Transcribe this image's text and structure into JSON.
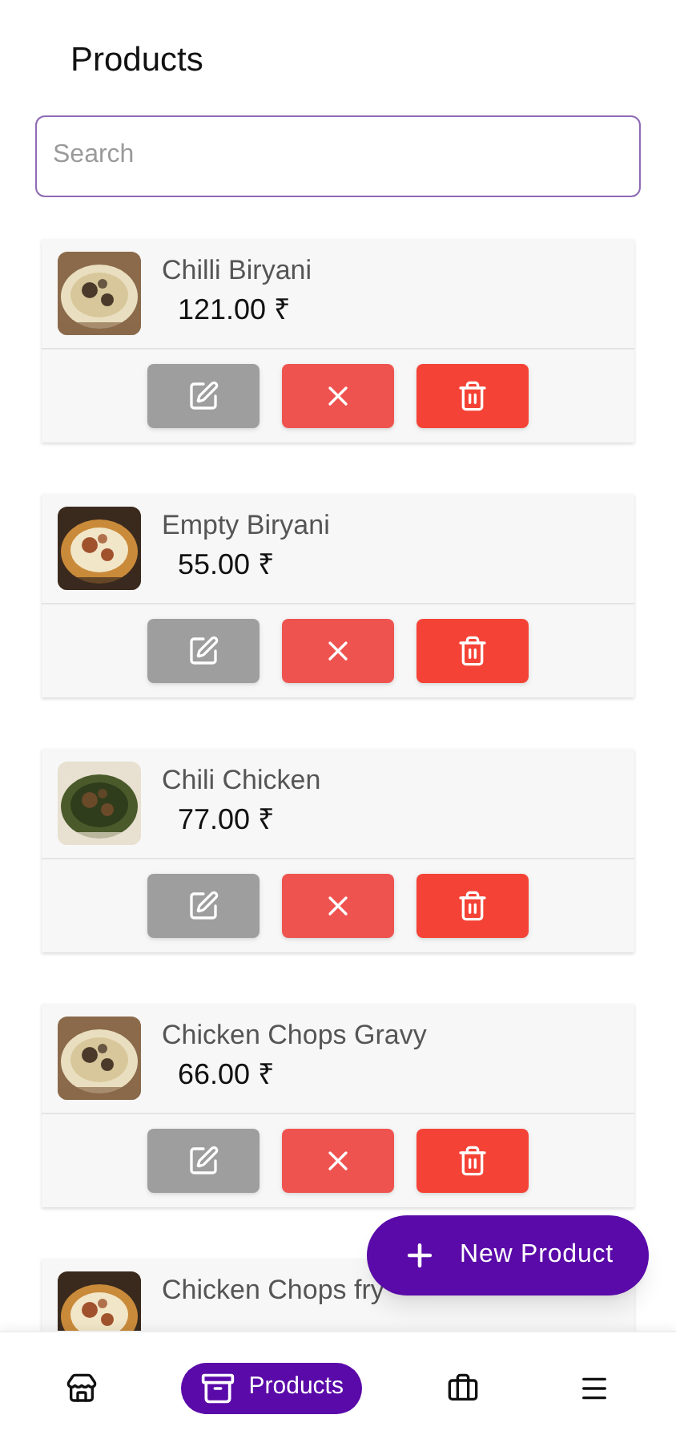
{
  "header": {
    "title": "Products"
  },
  "search": {
    "placeholder": "Search"
  },
  "products": [
    {
      "name": "Chilli Biryani",
      "price": "121.00 ₹"
    },
    {
      "name": "Empty Biryani",
      "price": "55.00 ₹"
    },
    {
      "name": "Chili Chicken",
      "price": "77.00 ₹"
    },
    {
      "name": "Chicken Chops Gravy",
      "price": "66.00 ₹"
    },
    {
      "name": "Chicken Chops fry"
    }
  ],
  "fab": {
    "label": "New Product"
  },
  "bottom_nav": [
    {
      "selected": false
    },
    {
      "label": "Products",
      "selected": true
    },
    {
      "selected": false
    },
    {
      "selected": false
    }
  ]
}
